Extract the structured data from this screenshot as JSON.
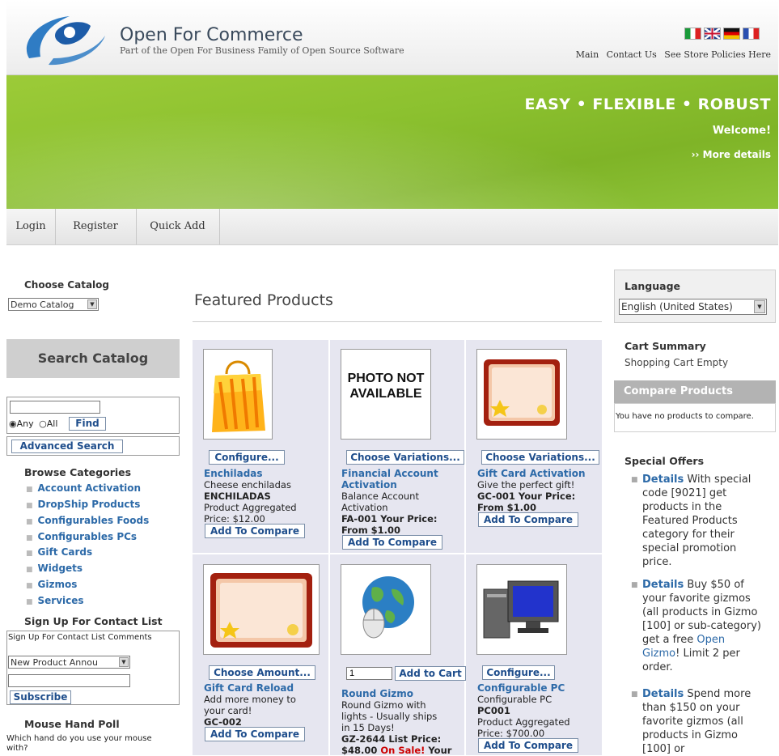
{
  "header": {
    "title": "Open For Commerce",
    "subtitle": "Part of the Open For Business Family of Open Source Software",
    "links": [
      "Main",
      "Contact Us",
      "See Store Policies Here"
    ]
  },
  "banner": {
    "tagline": "EASY • FLEXIBLE • ROBUST",
    "welcome": "Welcome!",
    "more": "›› More details"
  },
  "nav": {
    "items": [
      "Login",
      "Register",
      "Quick Add"
    ]
  },
  "left": {
    "choose_catalog_label": "Choose Catalog",
    "catalog_value": "Demo Catalog",
    "search_title": "Search Catalog",
    "search_value": "",
    "radio_any": "Any",
    "radio_all": "All",
    "find_label": "Find",
    "advanced_search": "Advanced Search",
    "browse_label": "Browse Categories",
    "categories": [
      "Account Activation",
      "DropShip Products",
      "Configurables Foods",
      "Configurables PCs",
      "Gift Cards",
      "Widgets",
      "Gizmos",
      "Services"
    ],
    "signup_label": "Sign Up For Contact List",
    "signup_text": "Sign Up For Contact List Comments",
    "signup_select": "New Product Annou",
    "signup_input": "",
    "subscribe_label": "Subscribe",
    "poll_label": "Mouse Hand Poll",
    "poll_text": "Which hand do you use your mouse with?"
  },
  "main": {
    "featured_title": "Featured Products",
    "products": [
      {
        "button": "Configure...",
        "name": "Enchiladas",
        "lines": [
          "Cheese enchiladas",
          "ENCHILADAS",
          "Product Aggregated",
          "Price: $12.00"
        ],
        "compare": "Add To Compare"
      },
      {
        "button": "Choose Variations...",
        "name": "Financial Account Activation",
        "lines": [
          "Balance Account",
          "Activation",
          "FA-001 Your Price:",
          "From $1.00"
        ],
        "compare": "Add To Compare",
        "image_text": "PHOTO NOT AVAILABLE"
      },
      {
        "button": "Choose Variations...",
        "name": "Gift Card Activation",
        "lines": [
          "Give the perfect gift!",
          "GC-001 Your Price:",
          "From $1.00"
        ],
        "compare": "Add To Compare"
      },
      {
        "button": "Choose Amount...",
        "name": "Gift Card Reload",
        "lines": [
          "Add more money to",
          "your card!",
          "GC-002"
        ],
        "compare": "Add To Compare"
      },
      {
        "button": "Add to Cart",
        "qty": "1",
        "name": "Round Gizmo",
        "lines": [
          "Round Gizmo with",
          "lights - Usually ships",
          "in 15 Days!",
          "GZ-2644 List Price:",
          "$48.00 On Sale! Your"
        ]
      },
      {
        "button": "Configure...",
        "name": "Configurable PC",
        "lines": [
          "Configurable PC",
          "PC001",
          "Product Aggregated",
          "Price: $700.00"
        ],
        "compare": "Add To Compare"
      }
    ]
  },
  "right": {
    "language_label": "Language",
    "language_value": "English (United States)",
    "cart_label": "Cart Summary",
    "cart_text": "Shopping Cart Empty",
    "compare_label": "Compare Products",
    "compare_text": "You have no products to compare.",
    "offers_label": "Special Offers",
    "offers": [
      {
        "link": "Details",
        "text": "With special code [9021] get products in the Featured Products category for their special promotion price."
      },
      {
        "link": "Details",
        "text": "Buy $50 of your favorite gizmos (all products in Gizmo [100] or sub-category) get a free",
        "link2": "Open Gizmo",
        "text2": "! Limit 2 per order."
      },
      {
        "link": "Details",
        "text": "Spend more than $150 on your favorite gizmos (all products in Gizmo [100] or"
      }
    ]
  },
  "colors": {
    "banner_green": "#8cc12f",
    "link_blue": "#2d6aa8",
    "sale_red": "#cc0000"
  }
}
